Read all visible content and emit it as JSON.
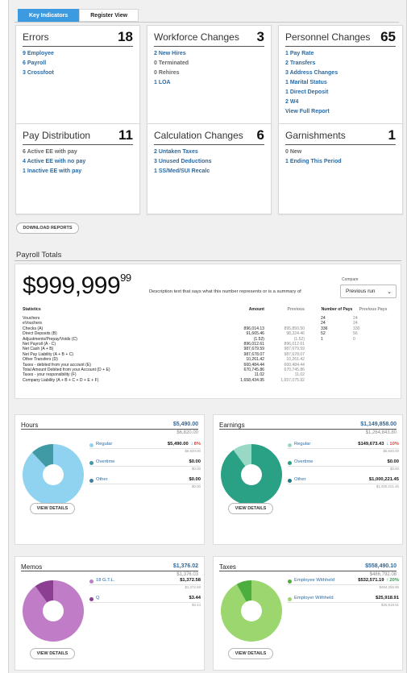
{
  "tabs": [
    "Key Indicators",
    "Register View"
  ],
  "cards": [
    {
      "title": "Errors",
      "count": "18",
      "items": [
        {
          "text": "9 Employee",
          "link": true
        },
        {
          "text": "6 Payroll",
          "link": true
        },
        {
          "text": "3 Crossfoot",
          "link": true
        }
      ]
    },
    {
      "title": "Workforce Changes",
      "count": "3",
      "items": [
        {
          "text": "2 New Hires",
          "link": true
        },
        {
          "text": "0 Terminated",
          "link": false
        },
        {
          "text": "0 Rehires",
          "link": false
        },
        {
          "text": "1 LOA",
          "link": true
        }
      ]
    },
    {
      "title": "Personnel Changes",
      "count": "65",
      "items": [
        {
          "text": "1 Pay Rate",
          "link": true
        },
        {
          "text": "2 Transfers",
          "link": true
        },
        {
          "text": "3 Address Changes",
          "link": true
        },
        {
          "text": "1 Marital Status",
          "link": true
        },
        {
          "text": "1 Direct Deposit",
          "link": true
        },
        {
          "text": "2 W4",
          "link": true
        },
        {
          "text": "View Full Report",
          "link": true
        }
      ]
    },
    {
      "title": "Pay Distribution",
      "count": "11",
      "items": [
        {
          "text": "6 Active EE with pay",
          "link": false
        },
        {
          "text": "4 Active EE with no pay",
          "link": true
        },
        {
          "text": "1 Inactive EE with pay",
          "link": true
        }
      ]
    },
    {
      "title": "Calculation Changes",
      "count": "6",
      "items": [
        {
          "text": "2 Untaken Taxes",
          "link": true
        },
        {
          "text": "3 Unused Deductions",
          "link": true
        },
        {
          "text": "1 SS/Med/SUI Recalc",
          "link": true
        }
      ]
    },
    {
      "title": "Garnishments",
      "count": "1",
      "items": [
        {
          "text": "0 New",
          "link": false
        },
        {
          "text": "1 Ending This Period",
          "link": true
        }
      ]
    }
  ],
  "download_label": "DOWNLOAD REPORTS",
  "payroll": {
    "section_title": "Payroll Totals",
    "big_whole": "$999,999",
    "big_cents": "99",
    "description": "Description text that says what this number represents or is a summary of",
    "compare_label": "Compare",
    "compare_value": "Previous run",
    "stats_headers": [
      "Statistics",
      "Amount",
      "Previous",
      "Number of Pays",
      "Previous Pays"
    ],
    "stats_rows": [
      [
        "Vouchers",
        "",
        "",
        "24",
        "24"
      ],
      [
        "eVouchers",
        "",
        "",
        "24",
        "24"
      ],
      [
        "Checks (A)",
        "896,014.13",
        "895,850.50",
        "336",
        "330"
      ],
      [
        "Direct Deposits (B)",
        "91,665.46",
        "98,324.46",
        "52",
        "56"
      ],
      [
        "Adjustments/Prepay/Voids (C)",
        "(1.52)",
        "(1.52)",
        "1",
        "0"
      ],
      [
        "Net Payroll (A - C)",
        "896,012.61",
        "896,012.61",
        "",
        ""
      ],
      [
        "Net Cash (A + B)",
        "987,679.59",
        "987,679.59",
        "",
        ""
      ],
      [
        "Net Pay Liability (A + B + C)",
        "987,678.07",
        "987,678.07",
        "",
        ""
      ],
      [
        "Other Transfers (D)",
        "10,261.42",
        "10,261.42",
        "",
        ""
      ],
      [
        "Taxes - debited from your account (E)",
        "660,484.44",
        "660,484.44",
        "",
        ""
      ],
      [
        "Total Amount Debited from your Account (D + E)",
        "670,745.86",
        "670,745.86",
        "",
        ""
      ],
      [
        "Taxes - your responsibility (F)",
        "11.02",
        "11.02",
        "",
        ""
      ],
      [
        "Company Liability (A + B + C + D + E + F)",
        "1,658,434.95",
        "1,657,075.92",
        "",
        ""
      ]
    ]
  },
  "panels": [
    {
      "title": "Hours",
      "total": "$5,490.00",
      "prev": "$6,820.00",
      "color_main": "#8fd3f0",
      "color_minor": "#3f9aa5",
      "pie_fractions": [
        0.88,
        0.12
      ],
      "pie_colors": [
        "#8fd3f0",
        "#3f9aa5"
      ],
      "legend": [
        {
          "name": "Regular",
          "value": "$5,490.00",
          "arrow": "↓",
          "arrow_color": "#2b6aa3",
          "pct": "8%",
          "pct_color": "#e0443a",
          "prev": "$6,820.00",
          "color": "#8fd3f0"
        },
        {
          "name": "Overtime",
          "value": "$0.00",
          "arrow": "",
          "arrow_color": "",
          "pct": "",
          "pct_color": "",
          "prev": "$0.00",
          "color": "#3f9aa5"
        },
        {
          "name": "Other",
          "value": "$0.00",
          "arrow": "",
          "arrow_color": "",
          "pct": "",
          "pct_color": "",
          "prev": "$0.00",
          "color": "#3f7fa0"
        }
      ],
      "button": "VIEW DETAILS"
    },
    {
      "title": "Earnings",
      "total": "$1,149,858.00",
      "prev": "$1,264,843.80",
      "pie_fractions": [
        0.9,
        0.1
      ],
      "pie_colors": [
        "#2aa085",
        "#9ad8c6"
      ],
      "legend": [
        {
          "name": "Regular",
          "value": "$149,673.43",
          "arrow": "↓",
          "arrow_color": "#2b6aa3",
          "pct": "10%",
          "pct_color": "#e0443a",
          "prev": "$6,820.00",
          "color": "#9ad8c6"
        },
        {
          "name": "Overtime",
          "value": "$0.00",
          "arrow": "",
          "arrow_color": "",
          "pct": "",
          "pct_color": "",
          "prev": "$0.00",
          "color": "#2aa085"
        },
        {
          "name": "Other",
          "value": "$1,000,221.45",
          "arrow": "",
          "arrow_color": "",
          "pct": "",
          "pct_color": "",
          "prev": "$1,000,221.45",
          "color": "#1f7a80"
        }
      ],
      "button": "VIEW DETAILS"
    },
    {
      "title": "Memos",
      "total": "$1,376.02",
      "prev": "$1,376.03",
      "pie_fractions": [
        0.9,
        0.1
      ],
      "pie_colors": [
        "#c07cc6",
        "#8c3f92"
      ],
      "legend": [
        {
          "name": "18 G.T.L.",
          "value": "$1,372.58",
          "arrow": "",
          "arrow_color": "",
          "pct": "",
          "pct_color": "",
          "prev": "$1,372.58",
          "color": "#c07cc6"
        },
        {
          "name": "Q",
          "value": "$3.44",
          "arrow": "",
          "arrow_color": "",
          "pct": "",
          "pct_color": "",
          "prev": "$3.44",
          "color": "#8c3f92"
        }
      ],
      "button": "VIEW DETAILS"
    },
    {
      "title": "Taxes",
      "total": "$558,490.10",
      "prev": "$486,792.08",
      "pie_fractions": [
        0.92,
        0.08
      ],
      "pie_colors": [
        "#9bd66e",
        "#4cae3e"
      ],
      "legend": [
        {
          "name": "Employee Withheld",
          "value": "$532,571.19",
          "arrow": "↑",
          "arrow_color": "#2aa04a",
          "pct": "20%",
          "pct_color": "#2aa04a",
          "prev": "$484,255.95",
          "color": "#4cae3e"
        },
        {
          "name": "Employer Withheld",
          "value": "$25,918.91",
          "arrow": "",
          "arrow_color": "",
          "pct": "",
          "pct_color": "",
          "prev": "$25,918.91",
          "color": "#9bd66e"
        }
      ],
      "button": "VIEW DETAILS"
    }
  ]
}
